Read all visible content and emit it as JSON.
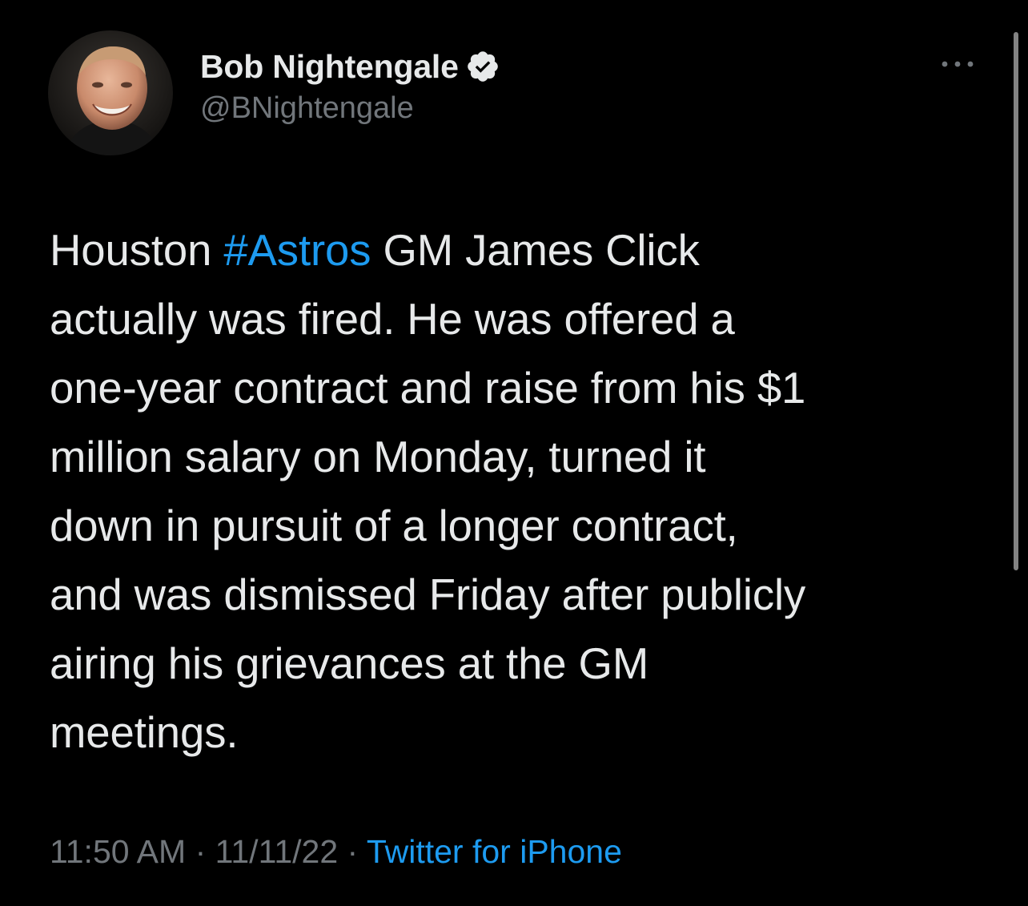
{
  "author": {
    "display_name": "Bob Nightengale",
    "handle": "@BNightengale",
    "verified_icon": "verified-badge-icon",
    "avatar_icon": "avatar-photo"
  },
  "menu": {
    "icon": "more-options-icon"
  },
  "tweet": {
    "lines": [
      {
        "before": "Houston ",
        "hashtag": "#Astros",
        "after": " GM James Click"
      },
      {
        "text": "actually was fired. He was offered a"
      },
      {
        "text": "one-year contract and raise from his $1"
      },
      {
        "text": "million salary on Monday, turned it"
      },
      {
        "text": "down in pursuit of a longer contract,"
      },
      {
        "text": "and was dismissed Friday after publicly"
      },
      {
        "text": "airing his grievances at the GM"
      },
      {
        "text": "meetings."
      }
    ]
  },
  "meta": {
    "time": "11:50 AM",
    "separator": " · ",
    "date": "11/11/22",
    "source": "Twitter for iPhone"
  },
  "colors": {
    "background": "#000000",
    "text": "#e7e9ea",
    "secondary": "#71767b",
    "accent": "#1d9bf0"
  }
}
